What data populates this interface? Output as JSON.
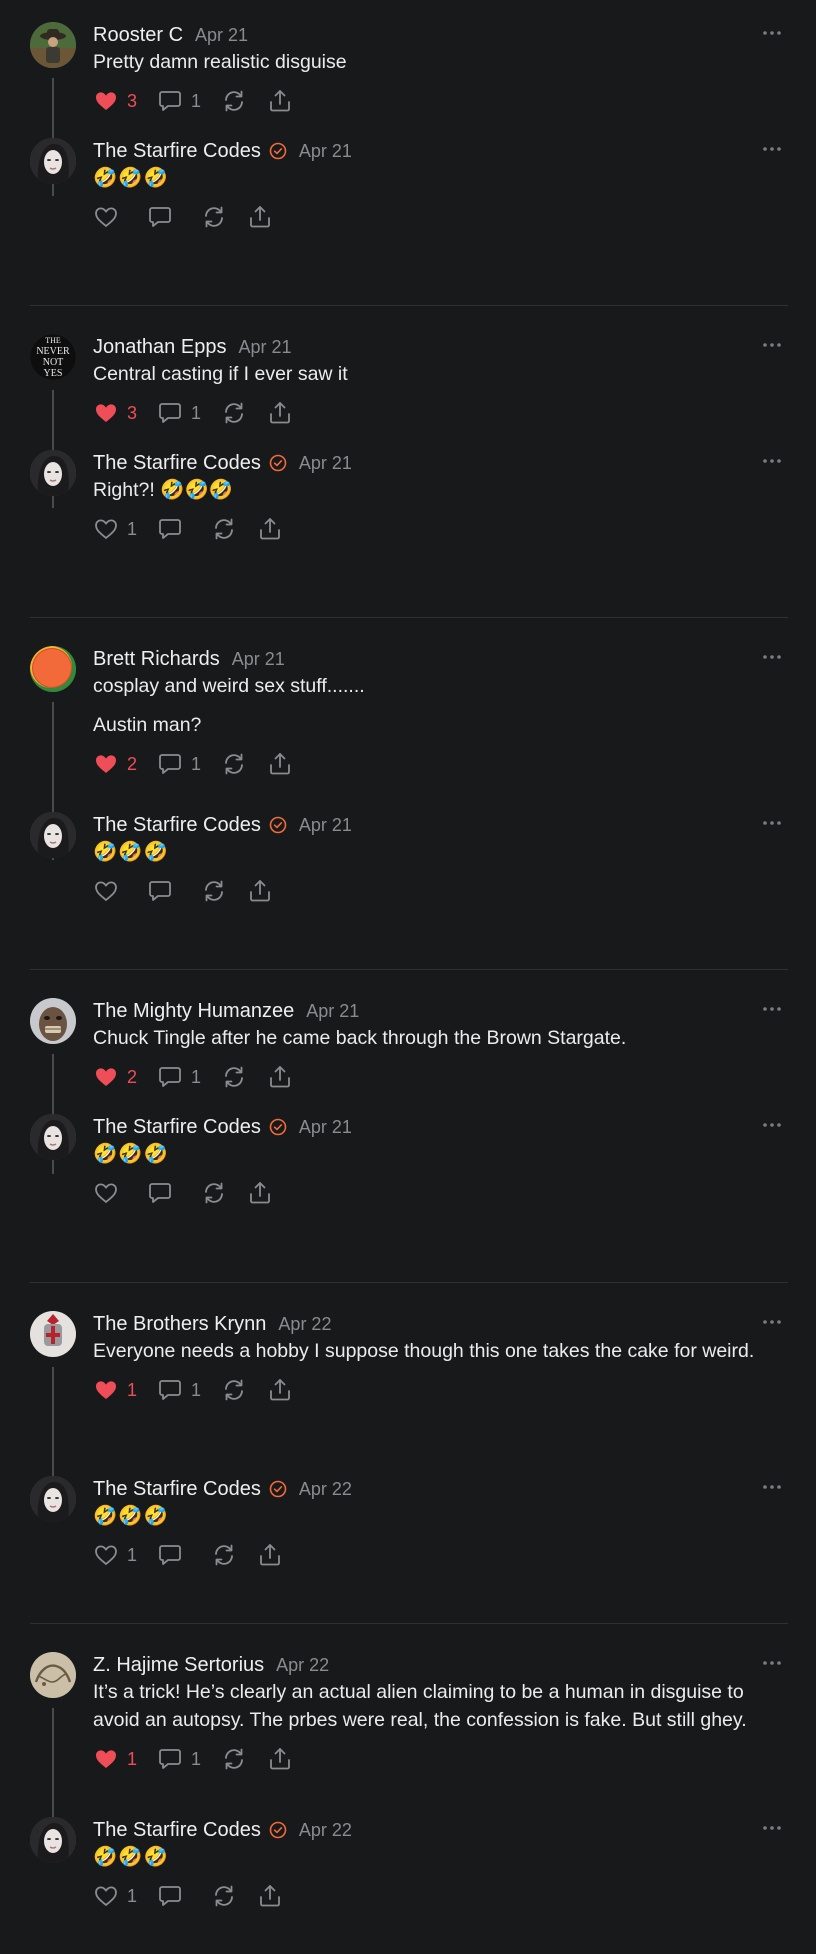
{
  "threads": [
    {
      "parent": {
        "author": "Rooster C",
        "date": "Apr 21",
        "avatar": "rooster",
        "verified": false,
        "paragraphs": [
          "Pretty damn realistic disguise"
        ],
        "likes": "3",
        "liked": true,
        "replies": "1"
      },
      "reply": {
        "author": "The Starfire Codes",
        "date": "Apr 21",
        "avatar": "starfire",
        "verified": true,
        "paragraphs": [
          "🤣🤣🤣"
        ],
        "likes": "",
        "liked": false,
        "replies": ""
      }
    },
    {
      "parent": {
        "author": "Jonathan Epps",
        "date": "Apr 21",
        "avatar": "nevernotyes",
        "verified": false,
        "paragraphs": [
          "Central casting if I ever saw it"
        ],
        "likes": "3",
        "liked": true,
        "replies": "1"
      },
      "reply": {
        "author": "The Starfire Codes",
        "date": "Apr 21",
        "avatar": "starfire",
        "verified": true,
        "paragraphs": [
          "Right?! 🤣🤣🤣"
        ],
        "likes": "1",
        "liked": false,
        "replies": ""
      }
    },
    {
      "parent": {
        "author": "Brett Richards",
        "date": "Apr 21",
        "avatar": "brett",
        "verified": false,
        "paragraphs": [
          "cosplay and weird sex stuff.......",
          "Austin man?"
        ],
        "likes": "2",
        "liked": true,
        "replies": "1"
      },
      "reply": {
        "author": "The Starfire Codes",
        "date": "Apr 21",
        "avatar": "starfire",
        "verified": true,
        "paragraphs": [
          "🤣🤣🤣"
        ],
        "likes": "",
        "liked": false,
        "replies": ""
      }
    },
    {
      "parent": {
        "author": "The Mighty Humanzee",
        "date": "Apr 21",
        "avatar": "humanzee",
        "verified": false,
        "paragraphs": [
          "Chuck Tingle after he came back through the Brown Stargate."
        ],
        "likes": "2",
        "liked": true,
        "replies": "1"
      },
      "reply": {
        "author": "The Starfire Codes",
        "date": "Apr 21",
        "avatar": "starfire",
        "verified": true,
        "paragraphs": [
          "🤣🤣🤣"
        ],
        "likes": "",
        "liked": false,
        "replies": ""
      }
    },
    {
      "parent": {
        "author": "The Brothers Krynn",
        "date": "Apr 22",
        "avatar": "krynn",
        "verified": false,
        "paragraphs": [
          "Everyone needs a hobby I suppose though this one takes the cake for weird."
        ],
        "likes": "1",
        "liked": true,
        "replies": "1"
      },
      "reply": {
        "author": "The Starfire Codes",
        "date": "Apr 22",
        "avatar": "starfire",
        "verified": true,
        "paragraphs": [
          "🤣🤣🤣"
        ],
        "likes": "1",
        "liked": false,
        "replies": ""
      }
    },
    {
      "parent": {
        "author": "Z. Hajime Sertorius",
        "date": "Apr 22",
        "avatar": "sertorius",
        "verified": false,
        "paragraphs": [
          "It’s a trick! He’s clearly an actual alien claiming to be a human in disguise to avoid an autopsy. The prbes were real, the confession is fake. But still ghey."
        ],
        "likes": "1",
        "liked": true,
        "replies": "1"
      },
      "reply": {
        "author": "The Starfire Codes",
        "date": "Apr 22",
        "avatar": "starfire",
        "verified": true,
        "paragraphs": [
          "🤣🤣🤣"
        ],
        "likes": "1",
        "liked": false,
        "replies": ""
      }
    }
  ],
  "avatar_text": {
    "nevernotyes": [
      "THE",
      "NEVER",
      "NOT",
      "YES"
    ]
  },
  "colors": {
    "background": "#18191b",
    "accent_like": "#ef4d57",
    "verified": "#f06a3c",
    "muted": "#8a8b8f"
  },
  "icons": {
    "like": "heart-icon",
    "comment": "comment-icon",
    "restack": "restack-icon",
    "share": "share-icon",
    "more": "more-icon",
    "verified": "verified-badge-icon"
  }
}
